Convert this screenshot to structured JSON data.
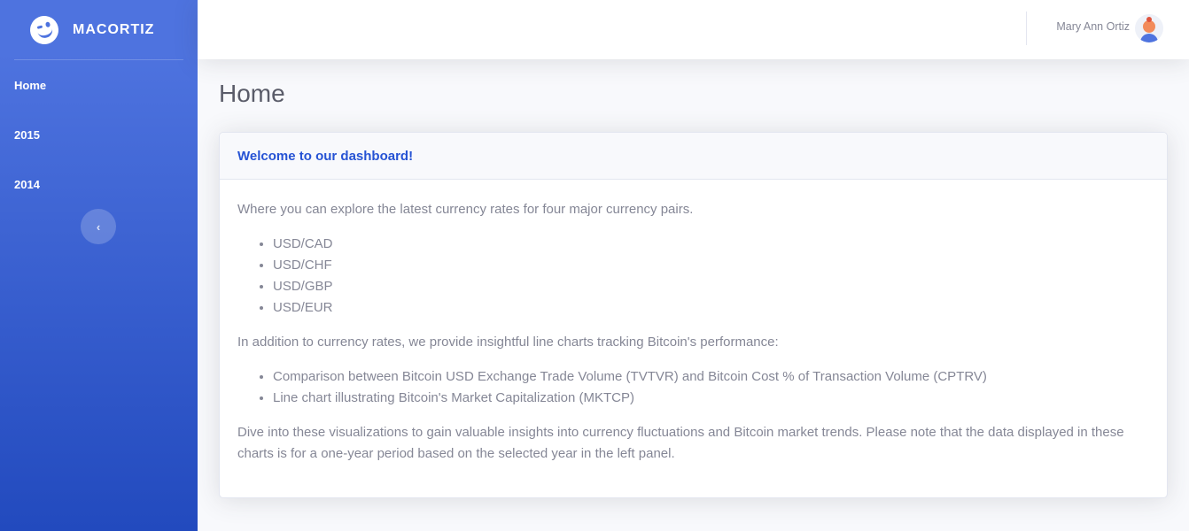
{
  "brand": {
    "name": "MACORTIZ",
    "icon": "wink-face-icon"
  },
  "sidebar": {
    "items": [
      {
        "label": "Home"
      },
      {
        "label": "2015"
      },
      {
        "label": "2014"
      }
    ],
    "toggle_icon": "chevron-left-icon",
    "toggle_glyph": "‹"
  },
  "topbar": {
    "user_name": "Mary Ann Ortiz",
    "avatar_icon": "user-avatar-icon"
  },
  "page": {
    "title": "Home"
  },
  "card": {
    "header": "Welcome to our dashboard!",
    "intro": "Where you can explore the latest currency rates for four major currency pairs.",
    "pairs": [
      "USD/CAD",
      "USD/CHF",
      "USD/GBP",
      "USD/EUR"
    ],
    "bitcoin_intro": "In addition to currency rates, we provide insightful line charts tracking Bitcoin's performance:",
    "bitcoin_items": [
      "Comparison between Bitcoin USD Exchange Trade Volume (TVTVR) and Bitcoin Cost % of Transaction Volume (CPTRV)",
      "Line chart illustrating Bitcoin's Market Capitalization (MKTCP)"
    ],
    "outro": "Dive into these visualizations to gain valuable insights into currency fluctuations and Bitcoin market trends. Please note that the data displayed in these charts is for a one-year period based on the selected year in the left panel."
  },
  "colors": {
    "sidebar_start": "#4e73df",
    "sidebar_end": "#224abe",
    "header_text": "#2653d4",
    "body_text": "#858796",
    "page_bg": "#f8f9fc"
  }
}
